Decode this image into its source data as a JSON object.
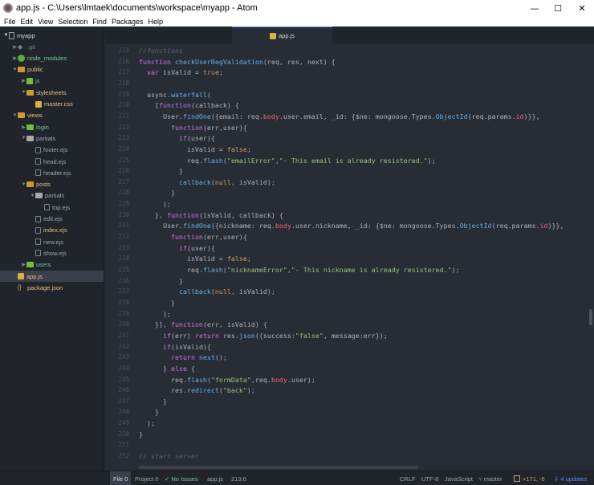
{
  "window": {
    "title": "app.js - C:\\Users\\lmtaek\\documents\\workspace\\myapp - Atom",
    "minimize_glyph": "—",
    "maximize_glyph": "☐",
    "close_glyph": "✕"
  },
  "menu": [
    "File",
    "Edit",
    "View",
    "Selection",
    "Find",
    "Packages",
    "Help"
  ],
  "tree": {
    "root": "myapp",
    "items": [
      {
        "label": ".git",
        "depth": 1,
        "type": "git",
        "arrow": "▶"
      },
      {
        "label": "node_modules",
        "depth": 1,
        "type": "node",
        "arrow": "▶"
      },
      {
        "label": "public",
        "depth": 1,
        "type": "folder-orange",
        "arrow": "▼"
      },
      {
        "label": "js",
        "depth": 2,
        "type": "js-folder",
        "arrow": "▶"
      },
      {
        "label": "stylesheets",
        "depth": 2,
        "type": "css-folder",
        "arrow": "▼"
      },
      {
        "label": "master.css",
        "depth": 3,
        "type": "css",
        "arrow": ""
      },
      {
        "label": "views",
        "depth": 1,
        "type": "folder-orange",
        "arrow": "▼"
      },
      {
        "label": "login",
        "depth": 2,
        "type": "folder-green",
        "arrow": "▶"
      },
      {
        "label": "partials",
        "depth": 2,
        "type": "folder",
        "arrow": "▼"
      },
      {
        "label": "footer.ejs",
        "depth": 3,
        "type": "file",
        "arrow": ""
      },
      {
        "label": "head.ejs",
        "depth": 3,
        "type": "file",
        "arrow": ""
      },
      {
        "label": "header.ejs",
        "depth": 3,
        "type": "file",
        "arrow": ""
      },
      {
        "label": "posts",
        "depth": 2,
        "type": "folder-orange",
        "arrow": "▼"
      },
      {
        "label": "partials",
        "depth": 3,
        "type": "folder",
        "arrow": "▼"
      },
      {
        "label": "top.ejs",
        "depth": 4,
        "type": "file",
        "arrow": ""
      },
      {
        "label": "edit.ejs",
        "depth": 3,
        "type": "file",
        "arrow": ""
      },
      {
        "label": "index.ejs",
        "depth": 3,
        "type": "file-orange",
        "arrow": ""
      },
      {
        "label": "new.ejs",
        "depth": 3,
        "type": "file",
        "arrow": ""
      },
      {
        "label": "show.ejs",
        "depth": 3,
        "type": "file",
        "arrow": ""
      },
      {
        "label": "users",
        "depth": 2,
        "type": "folder-green",
        "arrow": "▶"
      },
      {
        "label": "app.js",
        "depth": 1,
        "type": "js",
        "arrow": "",
        "selected": true
      },
      {
        "label": "package.json",
        "depth": 1,
        "type": "json",
        "arrow": ""
      }
    ]
  },
  "tab": {
    "label": "app.js",
    "icon": "js-file-icon"
  },
  "editor": {
    "lines": [
      {
        "n": "215",
        "html": "<span class=\"c\">//functions</span>"
      },
      {
        "n": "216",
        "html": "<span class=\"k\">function</span> <span class=\"f\">checkUserRegValidation</span>(req, res, next) {"
      },
      {
        "n": "217",
        "html": "  <span class=\"k\">var</span> isValid = <span class=\"n\">true</span>;"
      },
      {
        "n": "218",
        "html": ""
      },
      {
        "n": "219",
        "html": "  async.<span class=\"f\">waterfall</span>("
      },
      {
        "n": "220",
        "html": "    [<span class=\"k\">function</span>(callback) {"
      },
      {
        "n": "221",
        "html": "      User.<span class=\"f\">findOne</span>({email: req.<span class=\"v\">body</span>.user.email, _id: {$ne: mongoose.Types.<span class=\"f\">ObjectId</span>(req.params.<span class=\"v\">id</span>)}},"
      },
      {
        "n": "222",
        "html": "        <span class=\"k\">function</span>(err,user){"
      },
      {
        "n": "223",
        "html": "          <span class=\"k\">if</span>(user){"
      },
      {
        "n": "224",
        "html": "            isValid = <span class=\"n\">false</span>;"
      },
      {
        "n": "225",
        "html": "            req.<span class=\"f\">flash</span>(<span class=\"s\">\"emailError\"</span>,<span class=\"s\">\"- This email is already resistered.\"</span>);"
      },
      {
        "n": "226",
        "html": "          }"
      },
      {
        "n": "227",
        "html": "          <span class=\"f\">callback</span>(<span class=\"n\">null</span>, isValid);"
      },
      {
        "n": "228",
        "html": "        }"
      },
      {
        "n": "229",
        "html": "      );"
      },
      {
        "n": "230",
        "html": "    }, <span class=\"k\">function</span>(isValid, callback) {"
      },
      {
        "n": "231",
        "html": "      User.<span class=\"f\">findOne</span>({nickname: req.<span class=\"v\">body</span>.user.nickname, _id: {$ne: mongoose.Types.<span class=\"f\">ObjectId</span>(req.params.<span class=\"v\">id</span>)}},"
      },
      {
        "n": "232",
        "html": "        <span class=\"k\">function</span>(err,user){"
      },
      {
        "n": "233",
        "html": "          <span class=\"k\">if</span>(user){"
      },
      {
        "n": "234",
        "html": "            isValid = <span class=\"n\">false</span>;"
      },
      {
        "n": "235",
        "html": "            req.<span class=\"f\">flash</span>(<span class=\"s\">\"nicknameError\"</span>,<span class=\"s\">\"- This nickname is already resistered.\"</span>);"
      },
      {
        "n": "236",
        "html": "          }"
      },
      {
        "n": "237",
        "html": "          <span class=\"f\">callback</span>(<span class=\"n\">null</span>, isValid);"
      },
      {
        "n": "238",
        "html": "        }"
      },
      {
        "n": "239",
        "html": "      );"
      },
      {
        "n": "240",
        "html": "    }], <span class=\"k\">function</span>(err, isValid) {"
      },
      {
        "n": "241",
        "html": "      <span class=\"k\">if</span>(err) <span class=\"k\">return</span> res.<span class=\"f\">json</span>({success:<span class=\"s\">\"false\"</span>, message:err});"
      },
      {
        "n": "242",
        "html": "      <span class=\"k\">if</span>(isValid){"
      },
      {
        "n": "243",
        "html": "        <span class=\"k\">return</span> <span class=\"f\">next</span>();"
      },
      {
        "n": "244",
        "html": "      } <span class=\"k\">else</span> {"
      },
      {
        "n": "245",
        "html": "        req.<span class=\"f\">flash</span>(<span class=\"s\">\"formData\"</span>,req.<span class=\"v\">body</span>.user);"
      },
      {
        "n": "246",
        "html": "        res.<span class=\"f\">redirect</span>(<span class=\"s\">\"back\"</span>);"
      },
      {
        "n": "247",
        "html": "      }"
      },
      {
        "n": "248",
        "html": "    }"
      },
      {
        "n": "249",
        "html": "  );"
      },
      {
        "n": "250",
        "html": "}"
      },
      {
        "n": "251",
        "html": ""
      },
      {
        "n": "252",
        "html": "<span class=\"c\">// start server</span>"
      }
    ]
  },
  "status": {
    "file_count": "File 0",
    "project_count": "Project 0",
    "issues_icon": "check-icon",
    "issues": "No Issues",
    "filename": "app.js",
    "cursor": "213:6",
    "line_ending": "CRLF",
    "encoding": "UTF-8",
    "grammar": "JavaScript",
    "branch": "master",
    "git_diff": "+171, -6",
    "updates": "4 updates"
  }
}
